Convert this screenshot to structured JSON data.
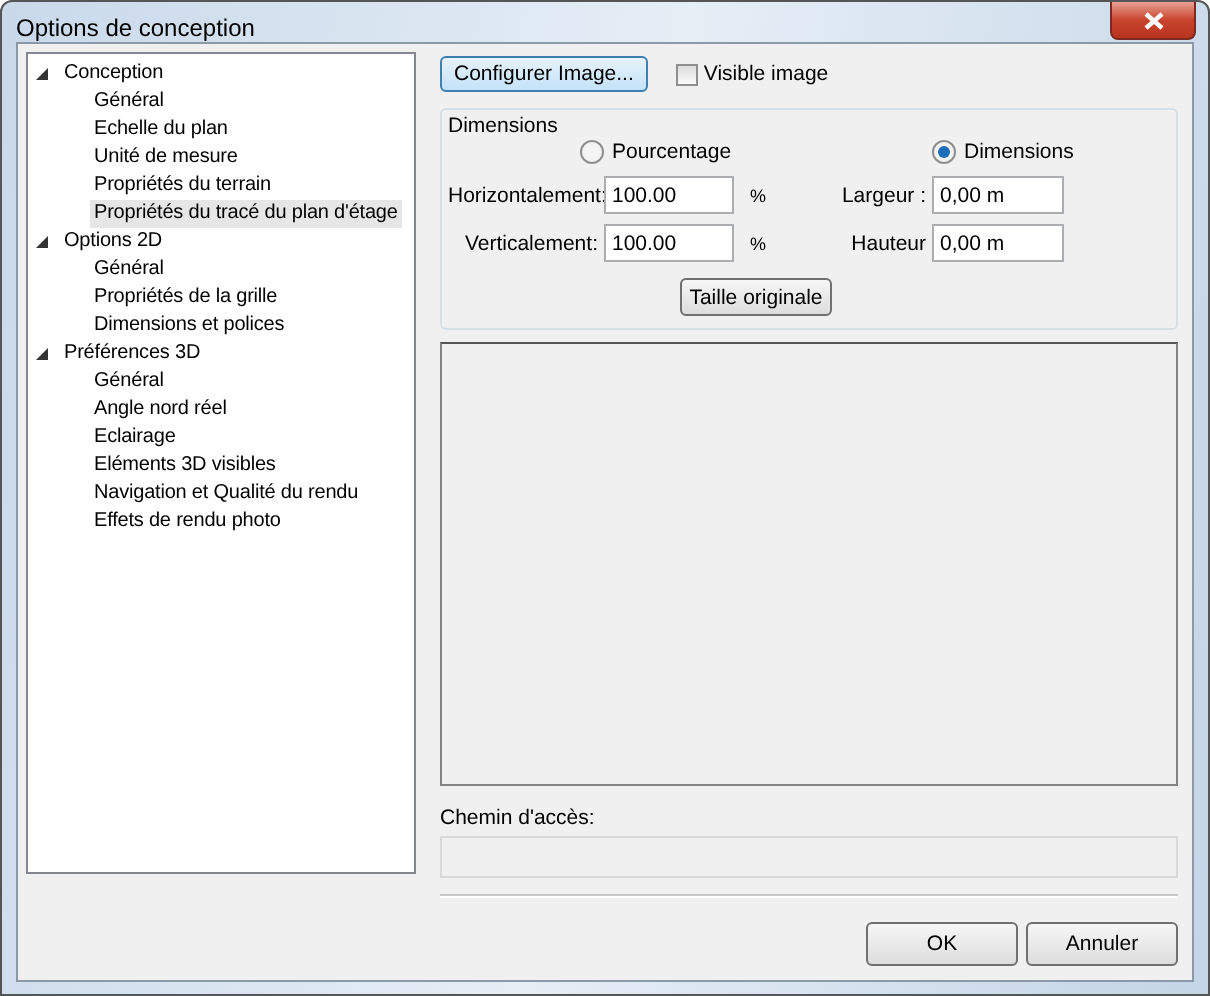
{
  "window": {
    "title": "Options de conception"
  },
  "tree": [
    {
      "label": "Conception",
      "expanded": true,
      "selected": false,
      "children": [
        {
          "label": "Général",
          "selected": false
        },
        {
          "label": "Echelle du plan",
          "selected": false
        },
        {
          "label": "Unité de mesure",
          "selected": false
        },
        {
          "label": "Propriétés du terrain",
          "selected": false
        },
        {
          "label": "Propriétés du tracé du plan d'étage",
          "selected": true
        }
      ]
    },
    {
      "label": "Options 2D",
      "expanded": true,
      "selected": false,
      "children": [
        {
          "label": "Général",
          "selected": false
        },
        {
          "label": "Propriétés de la grille",
          "selected": false
        },
        {
          "label": "Dimensions et polices",
          "selected": false
        }
      ]
    },
    {
      "label": "Préférences 3D",
      "expanded": true,
      "selected": false,
      "children": [
        {
          "label": "Général",
          "selected": false
        },
        {
          "label": "Angle nord réel",
          "selected": false
        },
        {
          "label": "Eclairage",
          "selected": false
        },
        {
          "label": "Eléments 3D visibles",
          "selected": false
        },
        {
          "label": "Navigation et Qualité du rendu",
          "selected": false
        },
        {
          "label": "Effets de rendu photo",
          "selected": false
        }
      ]
    }
  ],
  "configure_button": "Configurer Image...",
  "visible_image": {
    "label": "Visible image",
    "checked": false
  },
  "dimensions": {
    "title": "Dimensions",
    "modes": [
      {
        "label": "Pourcentage",
        "selected": false
      },
      {
        "label": "Dimensions",
        "selected": true
      }
    ],
    "rows": [
      {
        "label": "Horizontalement:",
        "value": "100.00",
        "unit": "%",
        "size_label": "Largeur :",
        "size_value": "0,00 m"
      },
      {
        "label": "Verticalement:",
        "value": "100.00",
        "unit": "%",
        "size_label": "Hauteur",
        "size_value": "0,00 m"
      }
    ],
    "reset_button": "Taille originale"
  },
  "path": {
    "label": "Chemin d'accès:"
  },
  "buttons": [
    "OK",
    "Annuler"
  ]
}
